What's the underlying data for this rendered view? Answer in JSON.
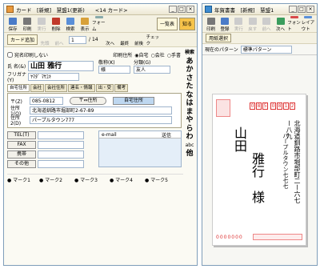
{
  "card": {
    "title": "カード　[新規]　慧盟1(更新)　　<14 カード>",
    "toolbar": [
      "保存",
      "印刷",
      "実行",
      "削除",
      "検索",
      "表示",
      "フォーム"
    ],
    "btn_list": "一覧表",
    "btn_know": "知る",
    "add_card": "カード追加",
    "nav": [
      "先頭",
      "前へ"
    ],
    "page": "1",
    "total": "/ 14",
    "nav2": [
      "次へ",
      "最終",
      "前後",
      "チェック"
    ],
    "no_print": "宛名印刷しない",
    "print_addr_label": "印刷住所",
    "print_addr_opts": [
      "自宅",
      "会社",
      "手書"
    ],
    "name_label": "氏 名(&)",
    "name_value": "山田 雅行",
    "kana_label": "フリガナ(Y)",
    "kana_value": "ﾔﾏﾀﾞ ﾏｻﾕｷ",
    "honorific_label": "敬称(K)",
    "honorific_value": "様",
    "category_label": "分類(G)",
    "category_value": "友人",
    "tabs": [
      "自宅住所",
      "会社",
      "会社住所",
      "連名・情報",
      "出・受",
      "備考"
    ],
    "zip_label": "〒(Z)",
    "zip_value": "085-0812",
    "zip_btn": "〒⇔住所",
    "home_addr_btn": "自宅住所",
    "addr1_label": "住所1(O)",
    "addr1_value": "北海道釧路市堀部町2-67-89",
    "addr2_label": "住所2(D)",
    "addr2_value": "パープルタウン777",
    "contact_btns": [
      "TEL(T)",
      "FAX",
      "携帯",
      "その他"
    ],
    "email_header": "e-mail",
    "send_header": "送信",
    "marks": [
      "マーク1",
      "マーク2",
      "マーク3",
      "マーク4",
      "マーク5"
    ],
    "kana_index": [
      "検索",
      "あ",
      "か",
      "さ",
      "た",
      "な",
      "は",
      "ま",
      "や",
      "ら",
      "わ",
      "abc",
      "他"
    ]
  },
  "nenga": {
    "title": "年賀書書　[新規]　慧盟1",
    "toolbar": [
      "印刷",
      "登録",
      "実行",
      "戻す",
      "前へ",
      "次へ",
      "フォント",
      "レイアウト"
    ],
    "select_btn": "用紙選択",
    "pattern_label": "現在のパターン",
    "pattern_value": "標準パターン",
    "postal_digits": [
      "0",
      "8",
      "5",
      "0",
      "8",
      "1",
      "2"
    ],
    "recipient_name_surname": "山田",
    "recipient_name_given": "雅行",
    "recipient_honorific": "様",
    "recipient_addr": "北海道釧路市堀部町二ー六七ー八九",
    "recipient_addr2": "パープルタウン七七七",
    "sender_zip": "0000000"
  }
}
